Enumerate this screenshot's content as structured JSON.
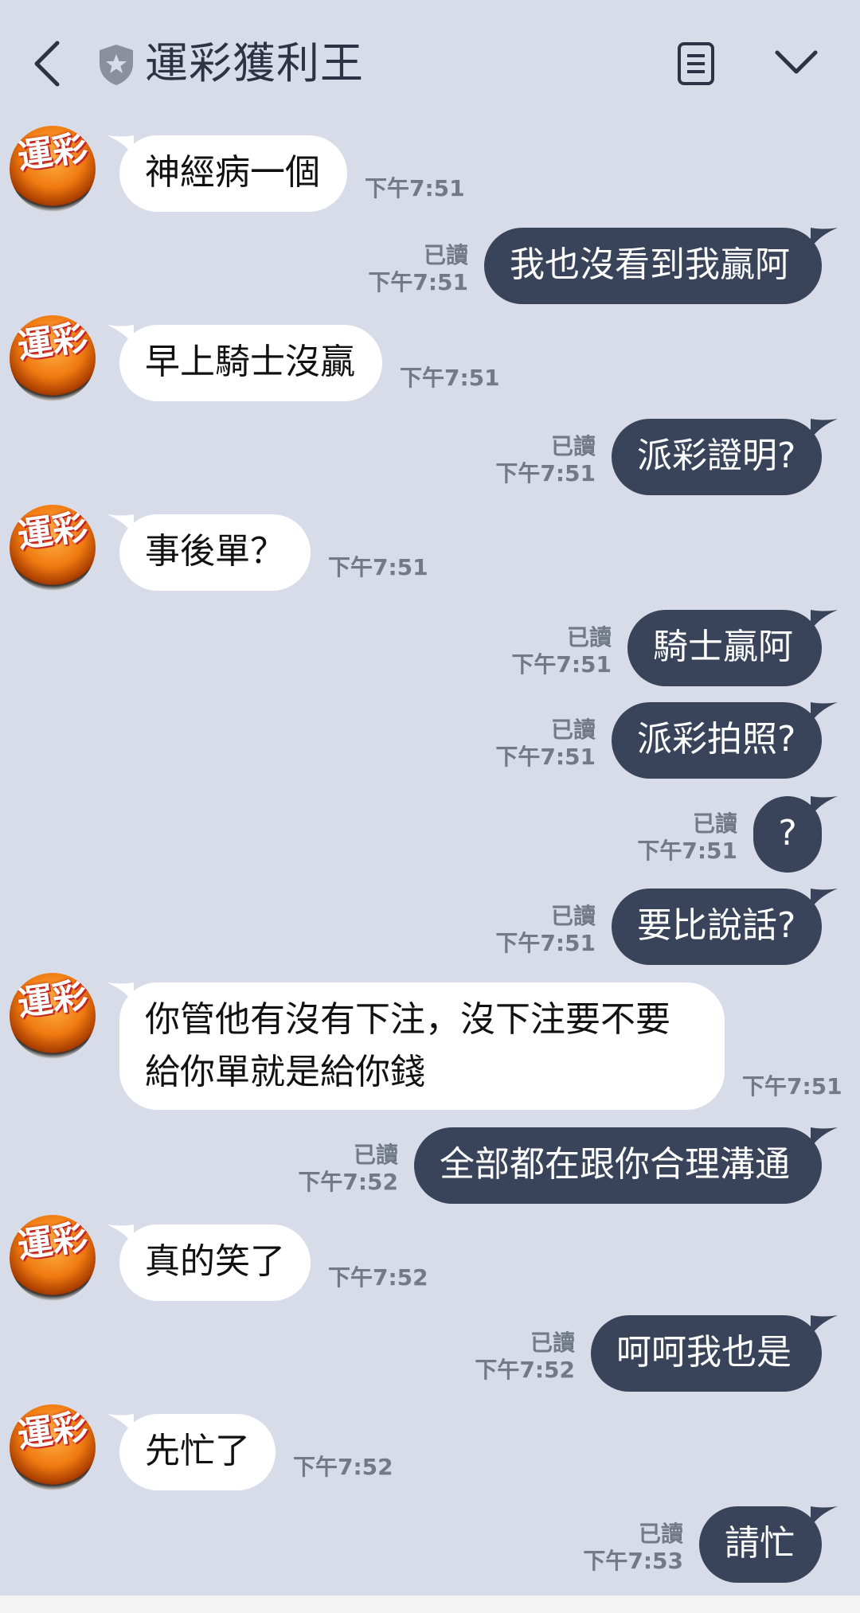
{
  "header": {
    "title": "運彩獲利王",
    "back_icon": "chevron-left-icon",
    "badge_icon": "shield-star-icon",
    "menu_icon": "notes-icon",
    "more_icon": "chevron-down-icon"
  },
  "avatar_text": "運彩",
  "read_label": "已讀",
  "colors": {
    "background": "#d7dce8",
    "incoming_bubble": "#ffffff",
    "outgoing_bubble": "#394359"
  },
  "messages": [
    {
      "dir": "in",
      "text": "神經病一個",
      "time": "下午7:51"
    },
    {
      "dir": "out",
      "text": "我也沒看到我贏阿",
      "time": "下午7:51",
      "read": true
    },
    {
      "dir": "in",
      "text": "早上騎士沒贏",
      "time": "下午7:51"
    },
    {
      "dir": "out",
      "text": "派彩證明?",
      "time": "下午7:51",
      "read": true
    },
    {
      "dir": "in",
      "text": "事後單？",
      "time": "下午7:51"
    },
    {
      "dir": "out",
      "text": "騎士贏阿",
      "time": "下午7:51",
      "read": true
    },
    {
      "dir": "out",
      "text": "派彩拍照?",
      "time": "下午7:51",
      "read": true
    },
    {
      "dir": "out",
      "text": "?",
      "time": "下午7:51",
      "read": true
    },
    {
      "dir": "out",
      "text": "要比說話?",
      "time": "下午7:51",
      "read": true
    },
    {
      "dir": "in",
      "text": "你管他有沒有下注，沒下注要不要\n給你單就是給你錢",
      "time": "下午7:51"
    },
    {
      "dir": "out",
      "text": "全部都在跟你合理溝通",
      "time": "下午7:52",
      "read": true
    },
    {
      "dir": "in",
      "text": "真的笑了",
      "time": "下午7:52"
    },
    {
      "dir": "out",
      "text": "呵呵我也是",
      "time": "下午7:52",
      "read": true
    },
    {
      "dir": "in",
      "text": "先忙了",
      "time": "下午7:52"
    },
    {
      "dir": "out",
      "text": "請忙",
      "time": "下午7:53",
      "read": true
    }
  ]
}
